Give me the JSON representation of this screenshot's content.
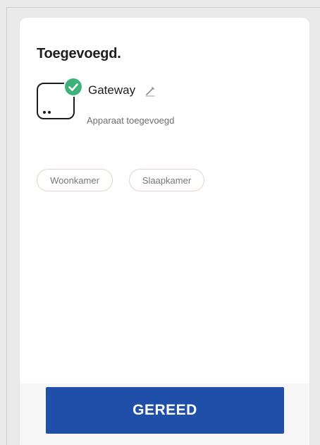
{
  "screen": {
    "title": "Toegevoegd."
  },
  "device": {
    "name": "Gateway",
    "status": "Apparaat toegevoegd",
    "icon": "gateway-device-icon",
    "badge_icon": "check-icon",
    "edit_icon": "pencil-icon"
  },
  "rooms": [
    {
      "label": "Woonkamer"
    },
    {
      "label": "Slaapkamer"
    }
  ],
  "actions": {
    "done_label": "GEREED"
  },
  "colors": {
    "accent": "#1f4fa8",
    "success": "#3eb27a",
    "chip_border": "#e3d4cc",
    "background": "#eaeaea"
  }
}
